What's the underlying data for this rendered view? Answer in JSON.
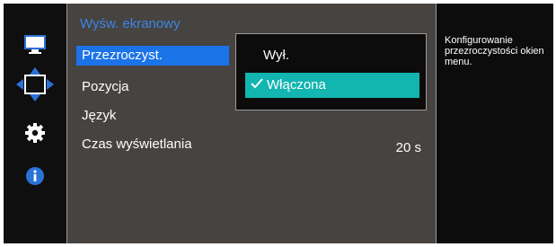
{
  "menu": {
    "title": "Wyśw. ekranowy",
    "items": [
      {
        "label": "Przezroczyst.",
        "value": ""
      },
      {
        "label": "Pozycja",
        "value": ""
      },
      {
        "label": "Język",
        "value": ""
      },
      {
        "label": "Czas wyświetlania",
        "value": "20 s"
      }
    ]
  },
  "submenu": {
    "options": [
      "Wył.",
      "Włączona"
    ],
    "selected": "Włączona"
  },
  "help": {
    "text": "Konfigurowanie przezroczystości okien menu."
  },
  "sidebar": {
    "icons": [
      "monitor-icon",
      "move-arrows-icon",
      "gear-icon",
      "info-icon"
    ]
  },
  "colors": {
    "accent": "#1b73e8",
    "title": "#3b86e6",
    "selected_option": "#12b5b0",
    "panel": "#474340"
  }
}
